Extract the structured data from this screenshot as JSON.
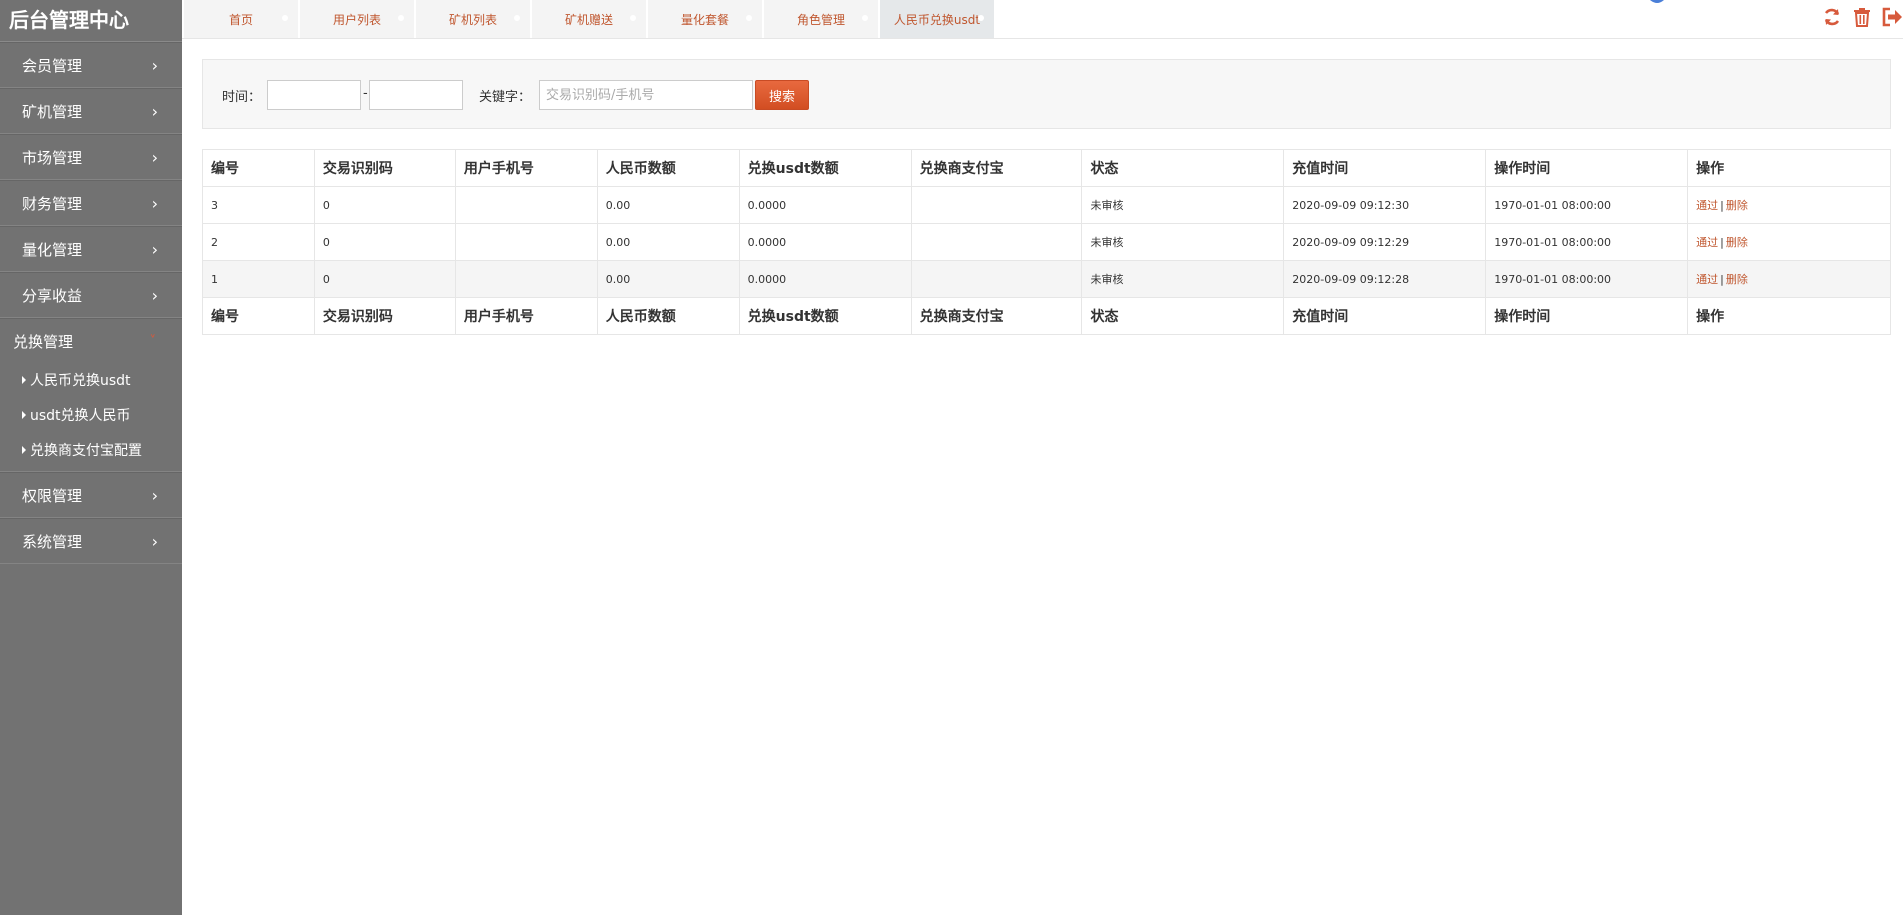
{
  "app": {
    "title": "后台管理中心"
  },
  "sidebar": {
    "items": [
      {
        "label": "会员管理"
      },
      {
        "label": "矿机管理"
      },
      {
        "label": "市场管理"
      },
      {
        "label": "财务管理"
      },
      {
        "label": "量化管理"
      },
      {
        "label": "分享收益"
      }
    ],
    "open": {
      "label": "兑换管理",
      "children": [
        {
          "label": "人民币兑换usdt"
        },
        {
          "label": "usdt兑换人民币"
        },
        {
          "label": "兑换商支付宝配置"
        }
      ]
    },
    "items_after": [
      {
        "label": "权限管理"
      },
      {
        "label": "系统管理"
      }
    ]
  },
  "tabs": [
    {
      "label": "首页"
    },
    {
      "label": "用户列表"
    },
    {
      "label": "矿机列表"
    },
    {
      "label": "矿机赠送"
    },
    {
      "label": "量化套餐"
    },
    {
      "label": "角色管理"
    },
    {
      "label": "人民币兑换usdt",
      "active": true
    }
  ],
  "top_icons": [
    "refresh-icon",
    "trash-icon",
    "logout-icon"
  ],
  "colors": {
    "accent": "#c0572f",
    "sidebar_bg": "#727272",
    "button": "#d9562a"
  },
  "search": {
    "time_label": "时间：",
    "range_separator": "-",
    "start_value": "",
    "end_value": "",
    "keyword_label": "关键字：",
    "keyword_value": "",
    "keyword_placeholder": "交易识别码/手机号",
    "button_label": "搜索"
  },
  "table": {
    "columns": [
      "编号",
      "交易识别码",
      "用户手机号",
      "人民币数额",
      "兑换usdt数额",
      "兑换商支付宝",
      "状态",
      "充值时间",
      "操作时间",
      "操作"
    ],
    "rows": [
      {
        "id": "3",
        "code": "0",
        "phone": "",
        "rmb": "0.00",
        "usdt": "0.0000",
        "alipay": "",
        "status": "未审核",
        "recharge_time": "2020-09-09 09:12:30",
        "op_time": "1970-01-01 08:00:00",
        "approve": "通过",
        "sep": "|",
        "delete": "删除"
      },
      {
        "id": "2",
        "code": "0",
        "phone": "",
        "rmb": "0.00",
        "usdt": "0.0000",
        "alipay": "",
        "status": "未审核",
        "recharge_time": "2020-09-09 09:12:29",
        "op_time": "1970-01-01 08:00:00",
        "approve": "通过",
        "sep": "|",
        "delete": "删除"
      },
      {
        "id": "1",
        "code": "0",
        "phone": "",
        "rmb": "0.00",
        "usdt": "0.0000",
        "alipay": "",
        "status": "未审核",
        "recharge_time": "2020-09-09 09:12:28",
        "op_time": "1970-01-01 08:00:00",
        "approve": "通过",
        "sep": "|",
        "delete": "删除"
      }
    ]
  }
}
